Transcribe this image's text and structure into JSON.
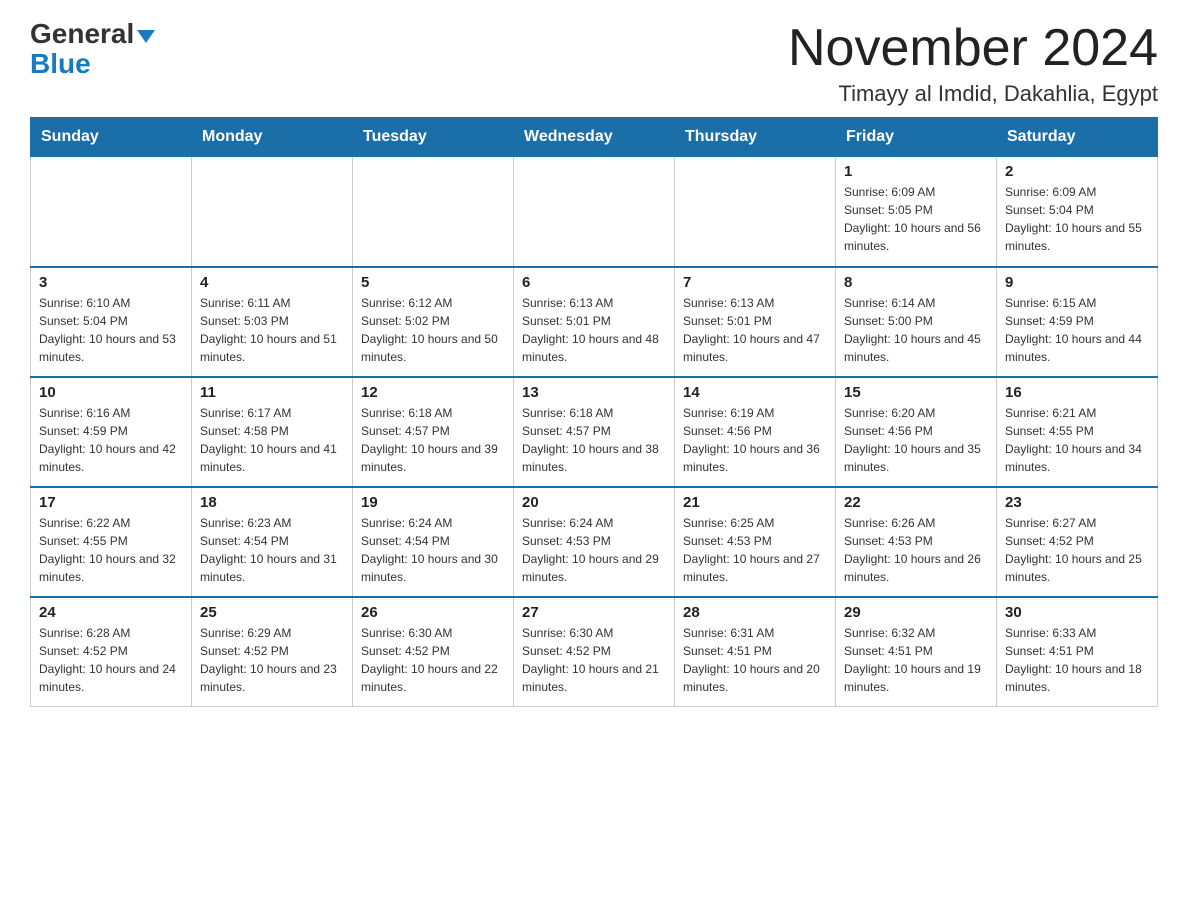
{
  "logo": {
    "general": "General",
    "arrow": "▼",
    "blue": "Blue"
  },
  "header": {
    "month_year": "November 2024",
    "location": "Timayy al Imdid, Dakahlia, Egypt"
  },
  "weekdays": [
    "Sunday",
    "Monday",
    "Tuesday",
    "Wednesday",
    "Thursday",
    "Friday",
    "Saturday"
  ],
  "weeks": [
    [
      {
        "day": "",
        "sunrise": "",
        "sunset": "",
        "daylight": ""
      },
      {
        "day": "",
        "sunrise": "",
        "sunset": "",
        "daylight": ""
      },
      {
        "day": "",
        "sunrise": "",
        "sunset": "",
        "daylight": ""
      },
      {
        "day": "",
        "sunrise": "",
        "sunset": "",
        "daylight": ""
      },
      {
        "day": "",
        "sunrise": "",
        "sunset": "",
        "daylight": ""
      },
      {
        "day": "1",
        "sunrise": "Sunrise: 6:09 AM",
        "sunset": "Sunset: 5:05 PM",
        "daylight": "Daylight: 10 hours and 56 minutes."
      },
      {
        "day": "2",
        "sunrise": "Sunrise: 6:09 AM",
        "sunset": "Sunset: 5:04 PM",
        "daylight": "Daylight: 10 hours and 55 minutes."
      }
    ],
    [
      {
        "day": "3",
        "sunrise": "Sunrise: 6:10 AM",
        "sunset": "Sunset: 5:04 PM",
        "daylight": "Daylight: 10 hours and 53 minutes."
      },
      {
        "day": "4",
        "sunrise": "Sunrise: 6:11 AM",
        "sunset": "Sunset: 5:03 PM",
        "daylight": "Daylight: 10 hours and 51 minutes."
      },
      {
        "day": "5",
        "sunrise": "Sunrise: 6:12 AM",
        "sunset": "Sunset: 5:02 PM",
        "daylight": "Daylight: 10 hours and 50 minutes."
      },
      {
        "day": "6",
        "sunrise": "Sunrise: 6:13 AM",
        "sunset": "Sunset: 5:01 PM",
        "daylight": "Daylight: 10 hours and 48 minutes."
      },
      {
        "day": "7",
        "sunrise": "Sunrise: 6:13 AM",
        "sunset": "Sunset: 5:01 PM",
        "daylight": "Daylight: 10 hours and 47 minutes."
      },
      {
        "day": "8",
        "sunrise": "Sunrise: 6:14 AM",
        "sunset": "Sunset: 5:00 PM",
        "daylight": "Daylight: 10 hours and 45 minutes."
      },
      {
        "day": "9",
        "sunrise": "Sunrise: 6:15 AM",
        "sunset": "Sunset: 4:59 PM",
        "daylight": "Daylight: 10 hours and 44 minutes."
      }
    ],
    [
      {
        "day": "10",
        "sunrise": "Sunrise: 6:16 AM",
        "sunset": "Sunset: 4:59 PM",
        "daylight": "Daylight: 10 hours and 42 minutes."
      },
      {
        "day": "11",
        "sunrise": "Sunrise: 6:17 AM",
        "sunset": "Sunset: 4:58 PM",
        "daylight": "Daylight: 10 hours and 41 minutes."
      },
      {
        "day": "12",
        "sunrise": "Sunrise: 6:18 AM",
        "sunset": "Sunset: 4:57 PM",
        "daylight": "Daylight: 10 hours and 39 minutes."
      },
      {
        "day": "13",
        "sunrise": "Sunrise: 6:18 AM",
        "sunset": "Sunset: 4:57 PM",
        "daylight": "Daylight: 10 hours and 38 minutes."
      },
      {
        "day": "14",
        "sunrise": "Sunrise: 6:19 AM",
        "sunset": "Sunset: 4:56 PM",
        "daylight": "Daylight: 10 hours and 36 minutes."
      },
      {
        "day": "15",
        "sunrise": "Sunrise: 6:20 AM",
        "sunset": "Sunset: 4:56 PM",
        "daylight": "Daylight: 10 hours and 35 minutes."
      },
      {
        "day": "16",
        "sunrise": "Sunrise: 6:21 AM",
        "sunset": "Sunset: 4:55 PM",
        "daylight": "Daylight: 10 hours and 34 minutes."
      }
    ],
    [
      {
        "day": "17",
        "sunrise": "Sunrise: 6:22 AM",
        "sunset": "Sunset: 4:55 PM",
        "daylight": "Daylight: 10 hours and 32 minutes."
      },
      {
        "day": "18",
        "sunrise": "Sunrise: 6:23 AM",
        "sunset": "Sunset: 4:54 PM",
        "daylight": "Daylight: 10 hours and 31 minutes."
      },
      {
        "day": "19",
        "sunrise": "Sunrise: 6:24 AM",
        "sunset": "Sunset: 4:54 PM",
        "daylight": "Daylight: 10 hours and 30 minutes."
      },
      {
        "day": "20",
        "sunrise": "Sunrise: 6:24 AM",
        "sunset": "Sunset: 4:53 PM",
        "daylight": "Daylight: 10 hours and 29 minutes."
      },
      {
        "day": "21",
        "sunrise": "Sunrise: 6:25 AM",
        "sunset": "Sunset: 4:53 PM",
        "daylight": "Daylight: 10 hours and 27 minutes."
      },
      {
        "day": "22",
        "sunrise": "Sunrise: 6:26 AM",
        "sunset": "Sunset: 4:53 PM",
        "daylight": "Daylight: 10 hours and 26 minutes."
      },
      {
        "day": "23",
        "sunrise": "Sunrise: 6:27 AM",
        "sunset": "Sunset: 4:52 PM",
        "daylight": "Daylight: 10 hours and 25 minutes."
      }
    ],
    [
      {
        "day": "24",
        "sunrise": "Sunrise: 6:28 AM",
        "sunset": "Sunset: 4:52 PM",
        "daylight": "Daylight: 10 hours and 24 minutes."
      },
      {
        "day": "25",
        "sunrise": "Sunrise: 6:29 AM",
        "sunset": "Sunset: 4:52 PM",
        "daylight": "Daylight: 10 hours and 23 minutes."
      },
      {
        "day": "26",
        "sunrise": "Sunrise: 6:30 AM",
        "sunset": "Sunset: 4:52 PM",
        "daylight": "Daylight: 10 hours and 22 minutes."
      },
      {
        "day": "27",
        "sunrise": "Sunrise: 6:30 AM",
        "sunset": "Sunset: 4:52 PM",
        "daylight": "Daylight: 10 hours and 21 minutes."
      },
      {
        "day": "28",
        "sunrise": "Sunrise: 6:31 AM",
        "sunset": "Sunset: 4:51 PM",
        "daylight": "Daylight: 10 hours and 20 minutes."
      },
      {
        "day": "29",
        "sunrise": "Sunrise: 6:32 AM",
        "sunset": "Sunset: 4:51 PM",
        "daylight": "Daylight: 10 hours and 19 minutes."
      },
      {
        "day": "30",
        "sunrise": "Sunrise: 6:33 AM",
        "sunset": "Sunset: 4:51 PM",
        "daylight": "Daylight: 10 hours and 18 minutes."
      }
    ]
  ]
}
